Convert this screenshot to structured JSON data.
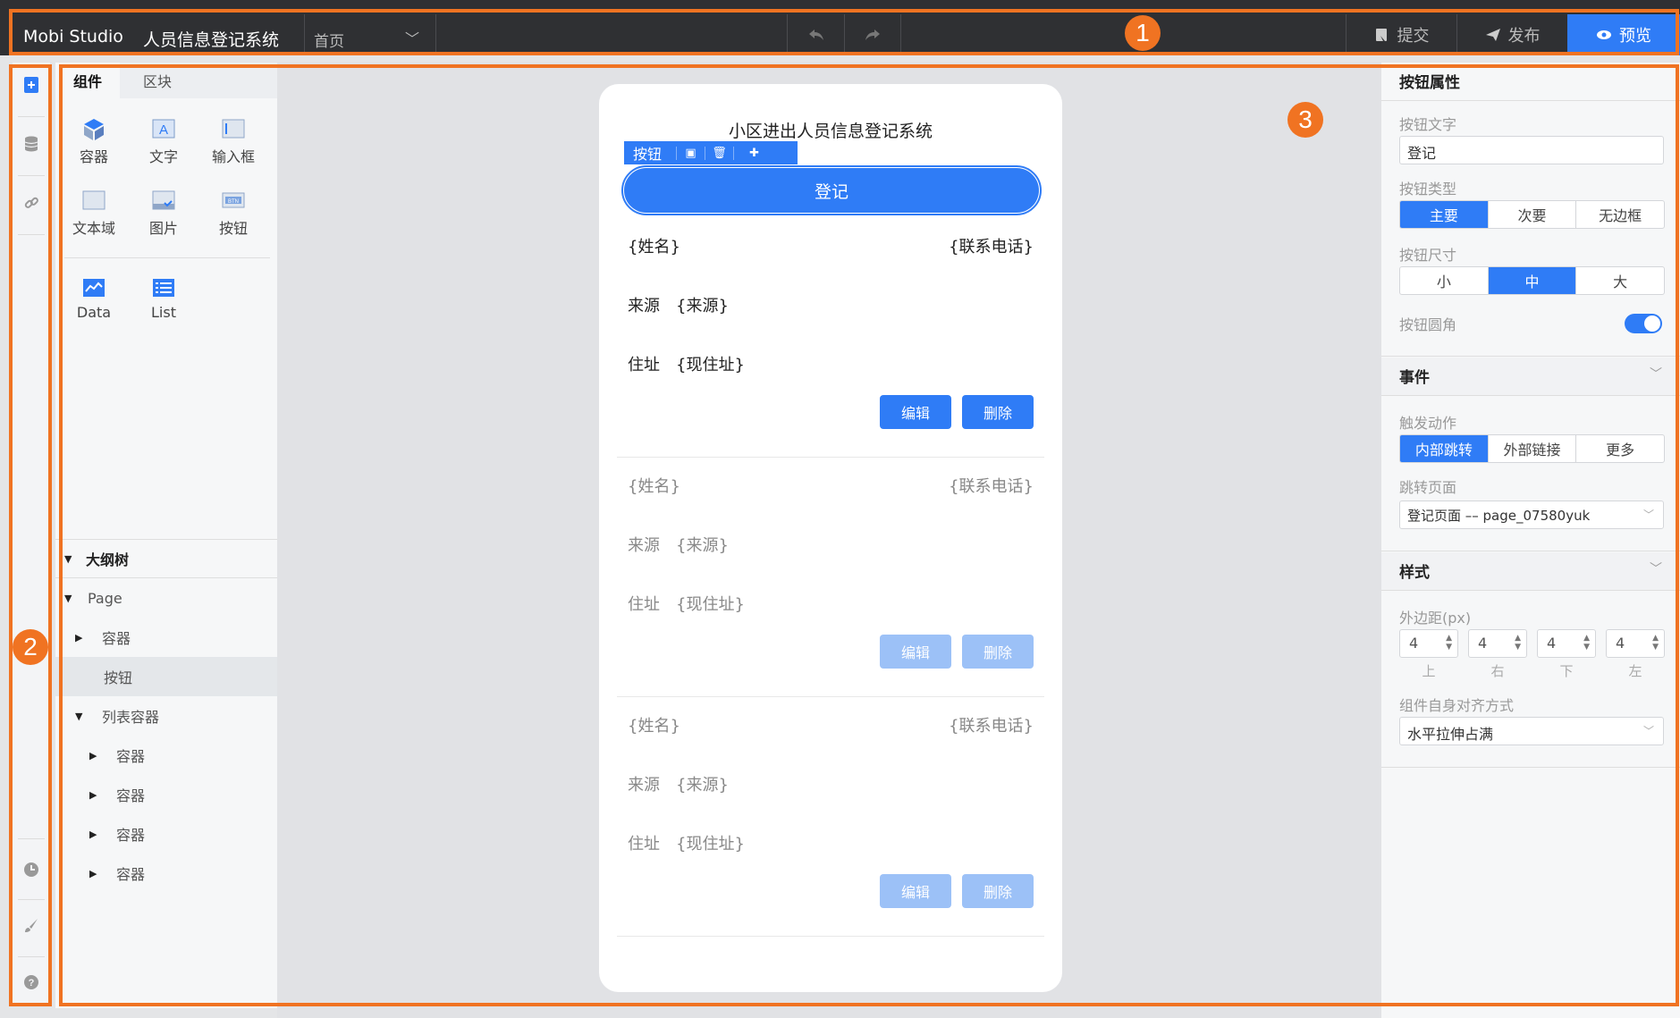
{
  "topbar": {
    "brand": "Mobi Studio",
    "app_name": "人员信息登记系统",
    "page_select": "首页",
    "submit": "提交",
    "publish": "发布",
    "preview": "预览"
  },
  "markers": [
    "1",
    "2",
    "3"
  ],
  "components": {
    "tabs": [
      "组件",
      "区块"
    ],
    "items": [
      {
        "label": "容器",
        "icon": "container-icon"
      },
      {
        "label": "文字",
        "icon": "text-icon"
      },
      {
        "label": "输入框",
        "icon": "input-icon"
      },
      {
        "label": "文本域",
        "icon": "textarea-icon"
      },
      {
        "label": "图片",
        "icon": "image-icon"
      },
      {
        "label": "按钮",
        "icon": "button-icon"
      },
      {
        "label": "Data",
        "icon": "data-icon"
      },
      {
        "label": "List",
        "icon": "list-icon"
      }
    ]
  },
  "outline": {
    "title": "大纲树",
    "nodes": [
      "Page",
      "容器",
      "按钮",
      "列表容器",
      "容器",
      "容器",
      "容器",
      "容器"
    ]
  },
  "canvas": {
    "title": "小区进出人员信息登记系统",
    "selection_label": "按钮",
    "main_button": "登记",
    "cards": [
      {
        "name": "{姓名}",
        "phone": "{联系电话}",
        "source_label": "来源",
        "source": "{来源}",
        "addr_label": "住址",
        "addr": "{现住址}",
        "edit": "编辑",
        "delete": "删除"
      },
      {
        "name": "{姓名}",
        "phone": "{联系电话}",
        "source_label": "来源",
        "source": "{来源}",
        "addr_label": "住址",
        "addr": "{现住址}",
        "edit": "编辑",
        "delete": "删除"
      },
      {
        "name": "{姓名}",
        "phone": "{联系电话}",
        "source_label": "来源",
        "source": "{来源}",
        "addr_label": "住址",
        "addr": "{现住址}",
        "edit": "编辑",
        "delete": "删除"
      }
    ]
  },
  "properties": {
    "section_button": "按钮属性",
    "text_label": "按钮文字",
    "text_value": "登记",
    "type_label": "按钮类型",
    "types": [
      "主要",
      "次要",
      "无边框"
    ],
    "size_label": "按钮尺寸",
    "sizes": [
      "小",
      "中",
      "大"
    ],
    "round_label": "按钮圆角",
    "round_on": true,
    "section_event": "事件",
    "action_label": "触发动作",
    "actions": [
      "内部跳转",
      "外部链接",
      "更多"
    ],
    "jump_label": "跳转页面",
    "jump_value": "登记页面 –– page_07580yuk",
    "section_style": "样式",
    "margin_label": "外边距(px)",
    "margins": [
      {
        "value": "4",
        "caption": "上"
      },
      {
        "value": "4",
        "caption": "右"
      },
      {
        "value": "4",
        "caption": "下"
      },
      {
        "value": "4",
        "caption": "左"
      }
    ],
    "align_label": "组件自身对齐方式",
    "align_value": "水平拉伸占满"
  },
  "colors": {
    "accent": "#2f7cf6",
    "annotation": "#f07322",
    "topbar": "#2f3033"
  }
}
